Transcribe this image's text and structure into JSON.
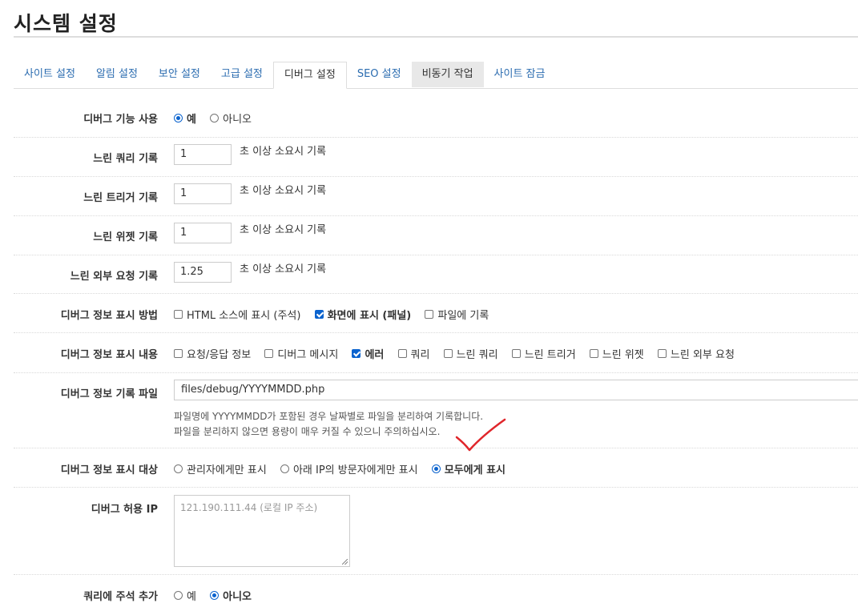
{
  "page": {
    "title": "시스템 설정"
  },
  "tabs": [
    {
      "label": "사이트 설정"
    },
    {
      "label": "알림 설정"
    },
    {
      "label": "보안 설정"
    },
    {
      "label": "고급 설정"
    },
    {
      "label": "디버그 설정",
      "active": true
    },
    {
      "label": "SEO 설정"
    },
    {
      "label": "비동기 작업",
      "highlighted": true
    },
    {
      "label": "사이트 잠금"
    }
  ],
  "debug_enable": {
    "label": "디버그 기능 사용",
    "options": [
      {
        "label": "예",
        "selected": true
      },
      {
        "label": "아니오",
        "selected": false
      }
    ]
  },
  "slow_query": {
    "label": "느린 쿼리 기록",
    "value": "1",
    "suffix": "초 이상 소요시 기록"
  },
  "slow_trigger": {
    "label": "느린 트리거 기록",
    "value": "1",
    "suffix": "초 이상 소요시 기록"
  },
  "slow_widget": {
    "label": "느린 위젯 기록",
    "value": "1",
    "suffix": "초 이상 소요시 기록"
  },
  "slow_remote": {
    "label": "느린 외부 요청 기록",
    "value": "1.25",
    "suffix": "초 이상 소요시 기록"
  },
  "display_method": {
    "label": "디버그 정보 표시 방법",
    "options": [
      {
        "label": "HTML 소스에 표시 (주석)",
        "checked": false
      },
      {
        "label": "화면에 표시 (패널)",
        "checked": true
      },
      {
        "label": "파일에 기록",
        "checked": false
      }
    ]
  },
  "display_content": {
    "label": "디버그 정보 표시 내용",
    "options": [
      {
        "label": "요청/응답 정보",
        "checked": false
      },
      {
        "label": "디버그 메시지",
        "checked": false
      },
      {
        "label": "에러",
        "checked": true
      },
      {
        "label": "쿼리",
        "checked": false
      },
      {
        "label": "느린 쿼리",
        "checked": false
      },
      {
        "label": "느린 트리거",
        "checked": false
      },
      {
        "label": "느린 위젯",
        "checked": false
      },
      {
        "label": "느린 외부 요청",
        "checked": false
      }
    ]
  },
  "log_file": {
    "label": "디버그 정보 기록 파일",
    "value": "files/debug/YYYYMMDD.php",
    "help1": "파일명에 YYYYMMDD가 포함된 경우 날짜별로 파일을 분리하여 기록합니다.",
    "help2": "파일을 분리하지 않으면 용량이 매우 커질 수 있으니 주의하십시오."
  },
  "display_target": {
    "label": "디버그 정보 표시 대상",
    "options": [
      {
        "label": "관리자에게만 표시",
        "selected": false
      },
      {
        "label": "아래 IP의 방문자에게만 표시",
        "selected": false
      },
      {
        "label": "모두에게 표시",
        "selected": true
      }
    ]
  },
  "allowed_ip": {
    "label": "디버그 허용 IP",
    "placeholder": "121.190.111.44 (로컬 IP 주소)"
  },
  "query_comment": {
    "label": "쿼리에 주석 추가",
    "options": [
      {
        "label": "예",
        "selected": false
      },
      {
        "label": "아니오",
        "selected": true
      }
    ]
  },
  "colors": {
    "accent": "#0b63ce",
    "tab_link": "#2b6cb0",
    "annotation": "#e0262b"
  }
}
